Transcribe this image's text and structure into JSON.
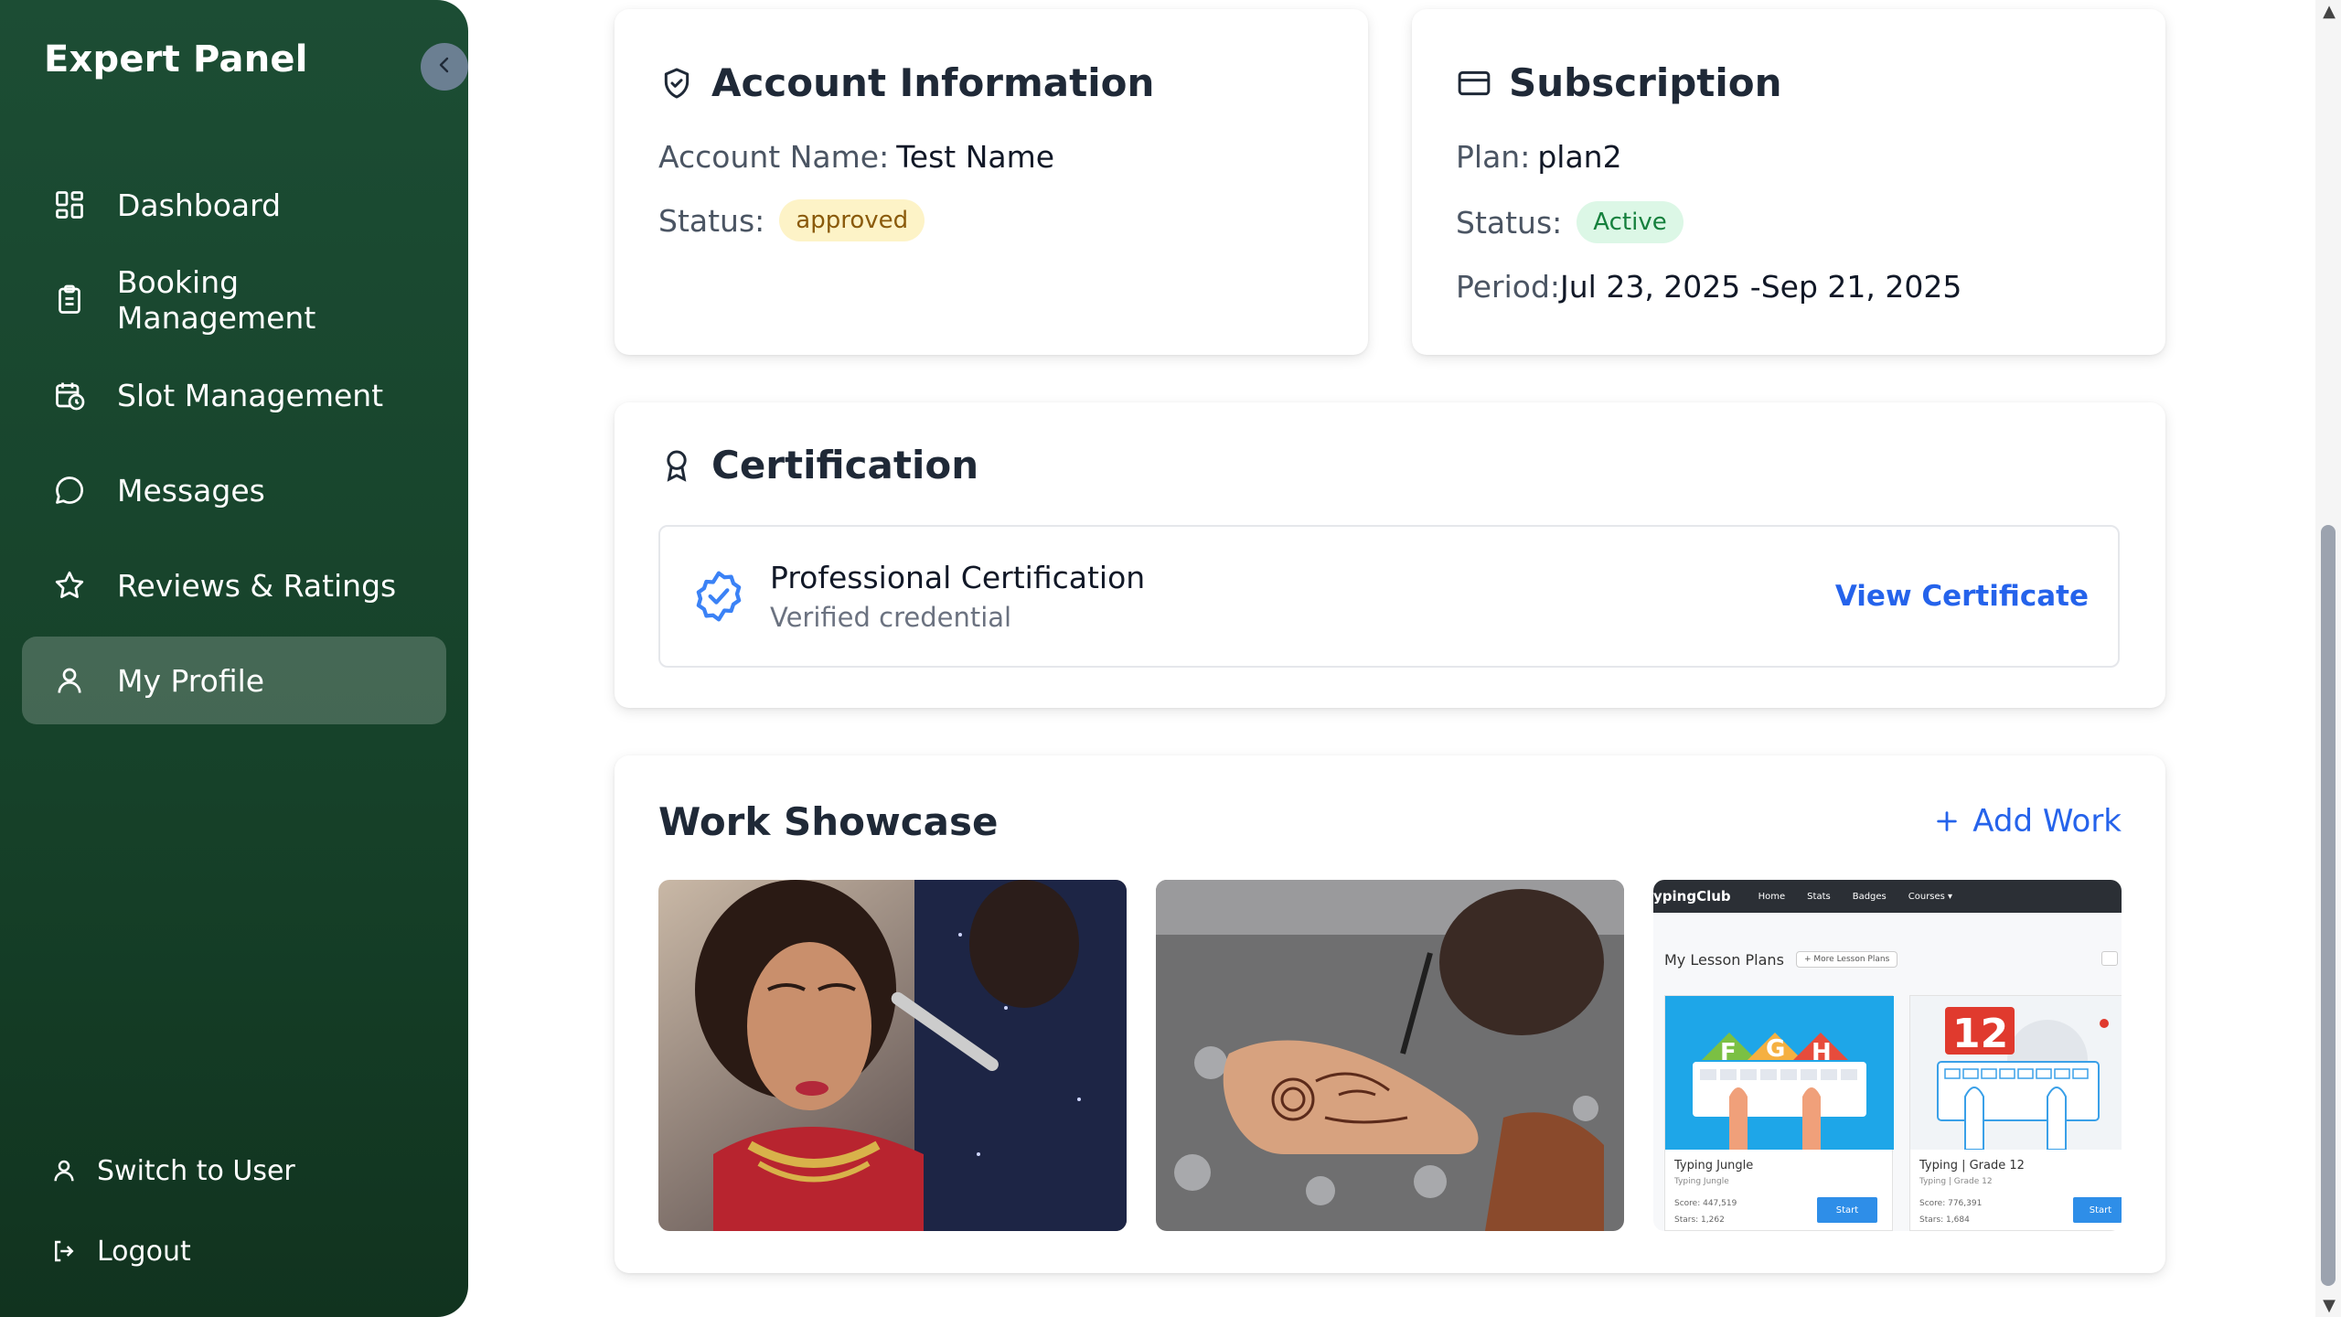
{
  "sidebar": {
    "brand": "Expert Panel",
    "items": [
      {
        "label": "Dashboard",
        "icon": "grid-icon"
      },
      {
        "label": "Booking Management",
        "icon": "clipboard-icon"
      },
      {
        "label": "Slot Management",
        "icon": "calendar-clock-icon"
      },
      {
        "label": "Messages",
        "icon": "chat-icon"
      },
      {
        "label": "Reviews & Ratings",
        "icon": "star-icon"
      },
      {
        "label": "My Profile",
        "icon": "user-icon",
        "active": true
      }
    ],
    "bottom": [
      {
        "label": "Switch to User",
        "icon": "user-icon"
      },
      {
        "label": "Logout",
        "icon": "logout-icon"
      }
    ]
  },
  "account": {
    "title": "Account Information",
    "name_label": "Account Name:",
    "name_value": "Test Name",
    "status_label": "Status:",
    "status_value": "approved"
  },
  "subscription": {
    "title": "Subscription",
    "plan_label": "Plan:",
    "plan_value": "plan2",
    "status_label": "Status:",
    "status_value": "Active",
    "period_label": "Period:",
    "period_value": "Jul 23, 2025 -Sep 21, 2025"
  },
  "certification": {
    "title": "Certification",
    "item_title": "Professional Certification",
    "item_sub": "Verified credential",
    "link": "View Certificate"
  },
  "showcase": {
    "title": "Work Showcase",
    "add_label": "Add Work",
    "items": [
      {
        "name": "bridal-makeup-photo"
      },
      {
        "name": "henna-photo"
      },
      {
        "name": "typing-lessons-screenshot",
        "brand": "ypingClub",
        "nav": [
          "Home",
          "Stats",
          "Badges",
          "Courses ▾"
        ],
        "heading": "My Lesson Plans",
        "button": "+ More Lesson Plans",
        "cards": [
          {
            "title": "Typing Jungle",
            "sub": "Typing Jungle",
            "score": "Score: 447,519",
            "stars": "Stars: 1,262",
            "btn": "Start"
          },
          {
            "title": "Typing | Grade 12",
            "sub": "Typing | Grade 12",
            "score": "Score: 776,391",
            "stars": "Stars: 1,684",
            "btn": "Start"
          }
        ],
        "grade": "12",
        "letters": [
          "F",
          "G",
          "H"
        ]
      }
    ]
  },
  "colors": {
    "sidebar": "#1c4d34",
    "accent": "#2563eb",
    "approved_bg": "#fdf3c7",
    "active_bg": "#dcf7e6"
  }
}
